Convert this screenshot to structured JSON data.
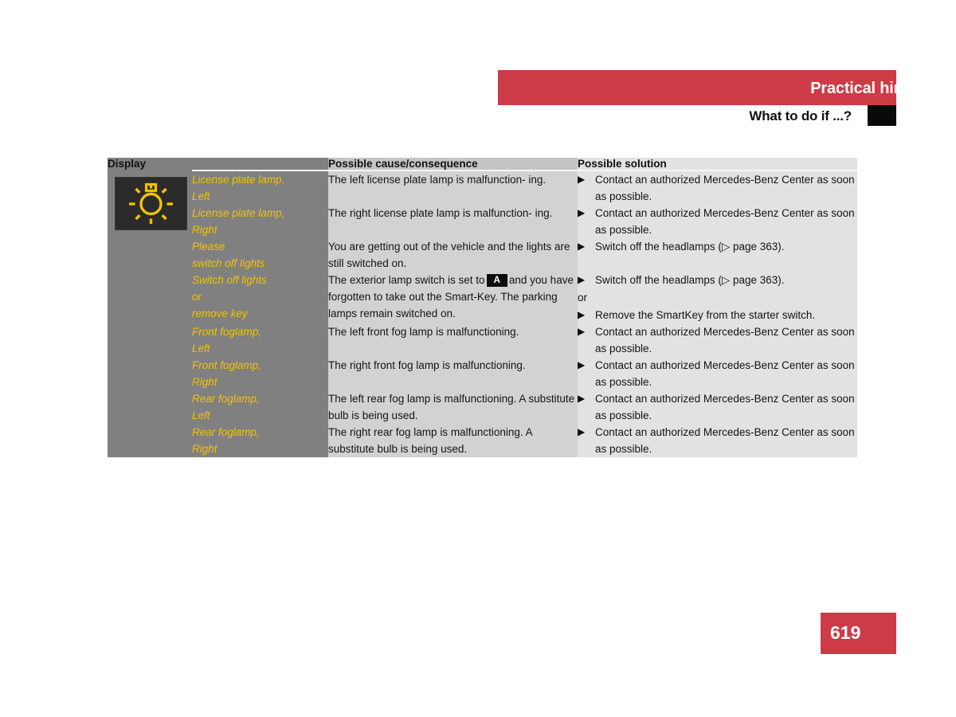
{
  "header": {
    "title": "Practical hints",
    "subtitle": "What to do if ...?",
    "accent_color": "#cd3b46",
    "square_color": "#0a0a0a"
  },
  "table": {
    "columns": [
      {
        "key": "icon",
        "label": "Display"
      },
      {
        "key": "display",
        "label": ""
      },
      {
        "key": "cause",
        "label": "Possible cause/consequence"
      },
      {
        "key": "solution",
        "label": "Possible solution"
      }
    ],
    "icon": {
      "name": "lamp-bulb-warning-icon",
      "color": "#f2c200",
      "background": "#2b2b2b"
    },
    "display_text_color": "#f2c200",
    "rows": [
      {
        "display": "License plate lamp,\nLeft",
        "display_line1": "License plate lamp,",
        "display_line2": "Left",
        "cause": "The left license plate lamp is malfunction-\ning.",
        "solution_bullets": [
          "Contact an authorized Mercedes-Benz Center as soon as possible."
        ]
      },
      {
        "display_line1": "License plate lamp,",
        "display_line2": "Right",
        "cause": "The right license plate lamp is malfunction-\ning.",
        "solution_bullets": [
          "Contact an authorized Mercedes-Benz Center as soon as possible."
        ]
      },
      {
        "display_line1": "Please",
        "display_line2": "switch off lights",
        "cause": "You are getting out of the vehicle and the lights are still switched on.",
        "solution_bullets": [
          "Switch off the headlamps (▷ page 363)."
        ]
      },
      {
        "display_line1": "Switch off lights",
        "display_line2": "or",
        "display_line3": "remove key",
        "cause_part1": "The exterior lamp switch is set to",
        "cause_badge": "A",
        "cause_part2": "and you have forgotten to take out the Smart-Key. The parking lamps remain switched on.",
        "solution_bullets": [
          "Switch off the headlamps (▷ page 363).",
          "Remove the SmartKey from the starter switch."
        ],
        "solution_separator": "or"
      },
      {
        "display_line1": "Front foglamp,",
        "display_line2": "Left",
        "cause": "The left front fog lamp is malfunctioning.",
        "solution_bullets": [
          "Contact an authorized Mercedes-Benz Center as soon as possible."
        ]
      },
      {
        "display_line1": "Front foglamp,",
        "display_line2": "Right",
        "cause": "The right front fog lamp is malfunctioning.",
        "solution_bullets": [
          "Contact an authorized Mercedes-Benz Center as soon as possible."
        ]
      },
      {
        "display_line1": "Rear foglamp,",
        "display_line2": "Left",
        "cause": "The left rear fog lamp is malfunctioning. A substitute bulb is being used.",
        "solution_bullets": [
          "Contact an authorized Mercedes-Benz Center as soon as possible."
        ]
      },
      {
        "display_line1": "Rear foglamp,",
        "display_line2": "Right",
        "cause": "The right rear fog lamp is malfunctioning. A substitute bulb is being used.",
        "solution_bullets": [
          "Contact an authorized Mercedes-Benz Center as soon as possible."
        ]
      }
    ]
  },
  "footer": {
    "page_number": "619",
    "badge_color": "#cd3b46"
  }
}
